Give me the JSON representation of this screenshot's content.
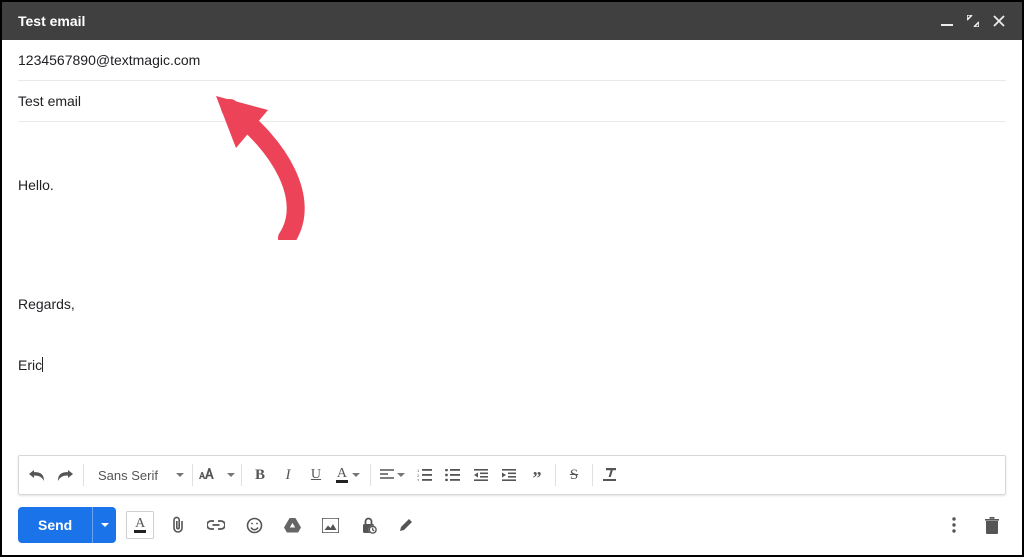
{
  "titlebar": {
    "title": "Test email"
  },
  "compose": {
    "recipient": "1234567890@textmagic.com",
    "subject": "Test email",
    "body_line1": "Hello.",
    "body_line2": "Regards,",
    "body_line3": "Eric"
  },
  "format": {
    "font_family": "Sans Serif"
  },
  "actions": {
    "send_label": "Send"
  }
}
